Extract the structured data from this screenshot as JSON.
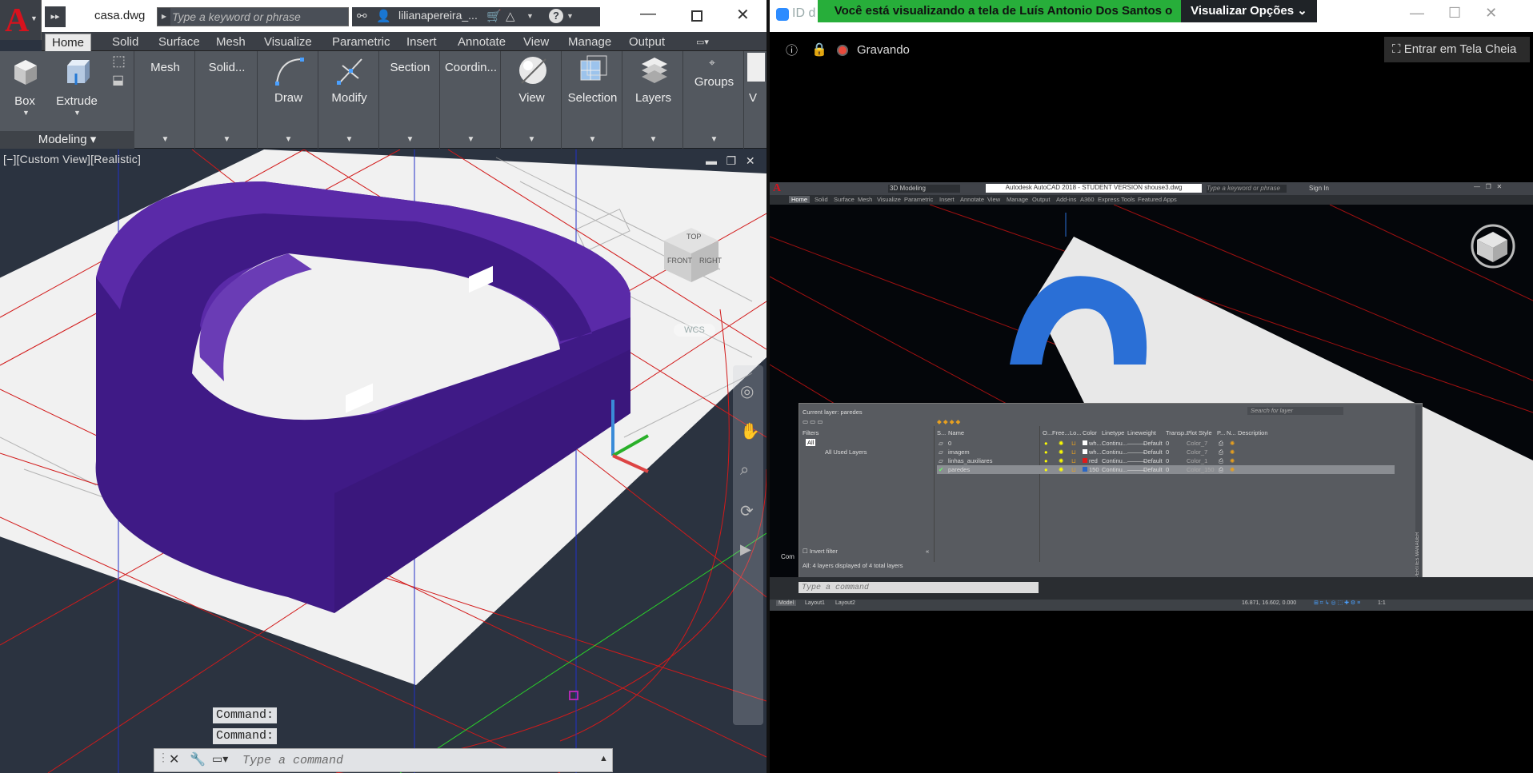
{
  "left": {
    "doc_title": "casa.dwg",
    "search": {
      "placeholder": "Type a keyword or phrase"
    },
    "user": "lilianapereira_...",
    "tabs": [
      "Home",
      "Solid",
      "Surface",
      "Mesh",
      "Visualize",
      "Parametric",
      "Insert",
      "Annotate",
      "View",
      "Manage",
      "Output"
    ],
    "panels": {
      "box": "Box",
      "extrude": "Extrude",
      "mesh": "Mesh",
      "solid": "Solid...",
      "draw": "Draw",
      "modify": "Modify",
      "section": "Section",
      "coordin": "Coordin...",
      "view": "View",
      "selection": "Selection",
      "layers": "Layers",
      "groups": "Groups",
      "modeling": "Modeling"
    },
    "viewport_label": "[−][Custom View][Realistic]",
    "viewcube": {
      "top": "TOP",
      "front": "FRONT",
      "right": "RIGHT",
      "wcs": "WCS"
    },
    "cmd_history": [
      "Command:",
      "Command:"
    ],
    "cmd_placeholder": "Type a command"
  },
  "right": {
    "zoom_id": "ID d",
    "banner": "Você está visualizando a tela de Luís Antonio Dos Santos o",
    "options": "Visualizar Opções",
    "recording": "Gravando",
    "fullscreen": "Entrar em Tela Cheia",
    "remote_title": "Autodesk AutoCAD 2018 - STUDENT VERSION   shouse3.dwg",
    "remote_workspace": "3D Modeling",
    "remote_search": "Type a keyword or phrase",
    "remote_signin": "Sign In",
    "remote_tabs": [
      "Home",
      "Solid",
      "Surface",
      "Mesh",
      "Visualize",
      "Parametric",
      "Insert",
      "Annotate",
      "View",
      "Manage",
      "Output",
      "Add-ins",
      "A360",
      "Express Tools",
      "Featured Apps"
    ],
    "lpm": {
      "current_layer": "Current layer: paredes",
      "search_placeholder": "Search for layer",
      "filters": "Filters",
      "filter_all": "All",
      "filter_used": "All Used Layers",
      "invert": "Invert filter",
      "status": "All: 4 layers displayed of 4 total layers",
      "side_title": "LAYER PROPERTIES MANAGER",
      "headers": [
        "S...",
        "Name",
        "O...",
        "Free...",
        "Lo...",
        "Color",
        "Linetype",
        "Lineweight",
        "Transp...",
        "Plot Style",
        "P...",
        "N...",
        "Description"
      ],
      "rows": [
        {
          "name": "0",
          "color_label": "wh...",
          "color_hex": "#ffffff",
          "linetype": "Continu...",
          "lineweight": "Default",
          "transp": "0",
          "plot": "Color_7"
        },
        {
          "name": "imagem",
          "color_label": "wh...",
          "color_hex": "#ffffff",
          "linetype": "Continu...",
          "lineweight": "Default",
          "transp": "0",
          "plot": "Color_7"
        },
        {
          "name": "linhas_auxiliares",
          "color_label": "red",
          "color_hex": "#e01a1a",
          "linetype": "Continu...",
          "lineweight": "Default",
          "transp": "0",
          "plot": "Color_1"
        },
        {
          "name": "paredes",
          "color_label": "150",
          "color_hex": "#2a66c4",
          "linetype": "Continu...",
          "lineweight": "Default",
          "transp": "0",
          "plot": "Color_150"
        }
      ]
    },
    "remote_cmd_partial": "Com",
    "remote_cmd_placeholder": "Type a command",
    "remote_layout_tabs": [
      "Model",
      "Layout1",
      "Layout2"
    ],
    "coords": "16.871, 16.602, 0.000",
    "scale": "1:1"
  }
}
